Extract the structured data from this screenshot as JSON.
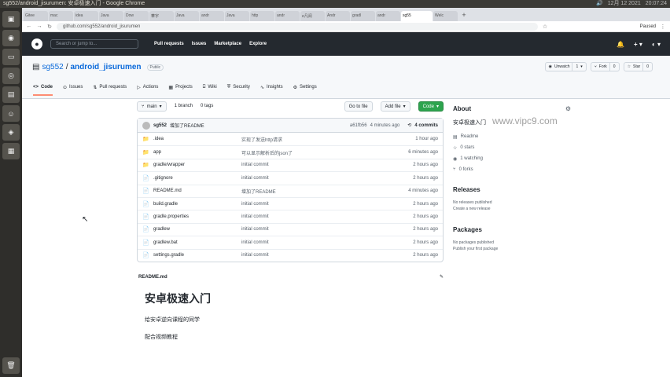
{
  "os": {
    "window_title": "sg552/android_jisurumen: 安卓极速入门 - Google Chrome",
    "tray": [
      "🔊",
      "12月 12 2021",
      "20:07:24"
    ]
  },
  "chrome": {
    "tabs": [
      "Gitee",
      "mac",
      "idea",
      "Java",
      "Dow",
      "華宇",
      "Java",
      "andr",
      "Java",
      "http",
      "andr",
      "e凡阅",
      "Andr",
      "gradl",
      "andr",
      "sg55",
      "Welc"
    ],
    "new_tab": "+",
    "url": "github.com/sg552/android_jisurumen",
    "paused": "Paused"
  },
  "gh": {
    "search_placeholder": "Search or jump to...",
    "nav": [
      "Pull requests",
      "Issues",
      "Marketplace",
      "Explore"
    ],
    "bell": "🔔",
    "plus": "+ ▾",
    "avatar": "◐ ▾"
  },
  "repo": {
    "owner": "sg552",
    "sep": "/",
    "name": "android_jisurumen",
    "visibility": "Public",
    "unwatch": "Unwatch",
    "watch_count": "1",
    "fork": "Fork",
    "fork_count": "0",
    "star": "Star",
    "star_count": "0",
    "tabs": [
      "Code",
      "Issues",
      "Pull requests",
      "Actions",
      "Projects",
      "Wiki",
      "Security",
      "Insights",
      "Settings"
    ],
    "tab_icons": [
      "<>",
      "⊙",
      "⇅",
      "▷",
      "▦",
      "⌸",
      "⛨",
      "∿",
      "⚙"
    ]
  },
  "files": {
    "branch": "main",
    "branches": "1 branch",
    "tags": "0 tags",
    "go_to_file": "Go to file",
    "add_file": "Add file",
    "code": "Code",
    "commit_author": "sg552",
    "commit_msg": "增加了README",
    "commit_hash": "a61fb56",
    "commit_age": "4 minutes ago",
    "commit_count": "4 commits",
    "rows": [
      {
        "name": ".idea",
        "msg": "实现了发送http请求",
        "age": "1 hour ago",
        "icon": "📁"
      },
      {
        "name": "app",
        "msg": "可以显示解析后的json了",
        "age": "6 minutes ago",
        "icon": "📁"
      },
      {
        "name": "gradle/wrapper",
        "msg": "initial commit",
        "age": "2 hours ago",
        "icon": "📁"
      },
      {
        "name": ".gitignore",
        "msg": "initial commit",
        "age": "2 hours ago",
        "icon": "📄"
      },
      {
        "name": "README.md",
        "msg": "增加了README",
        "age": "4 minutes ago",
        "icon": "📄"
      },
      {
        "name": "build.gradle",
        "msg": "initial commit",
        "age": "2 hours ago",
        "icon": "📄"
      },
      {
        "name": "gradle.properties",
        "msg": "initial commit",
        "age": "2 hours ago",
        "icon": "📄"
      },
      {
        "name": "gradlew",
        "msg": "initial commit",
        "age": "2 hours ago",
        "icon": "📄"
      },
      {
        "name": "gradlew.bat",
        "msg": "initial commit",
        "age": "2 hours ago",
        "icon": "📄"
      },
      {
        "name": "settings.gradle",
        "msg": "initial commit",
        "age": "2 hours ago",
        "icon": "📄"
      }
    ]
  },
  "readme": {
    "filename": "README.md",
    "title": "安卓极速入门",
    "p1": "给安卓逆向课程的同学",
    "p2": "配合视频教程"
  },
  "sidebar": {
    "about": "About",
    "desc": "安卓极速入门",
    "readme": "Readme",
    "stars": "0 stars",
    "watching": "1 watching",
    "forks": "0 forks",
    "releases": "Releases",
    "no_releases": "No releases published",
    "create_release": "Create a new release",
    "packages": "Packages",
    "no_packages": "No packages published",
    "publish_package": "Publish your first package"
  },
  "watermark": "www.vipc9.com"
}
